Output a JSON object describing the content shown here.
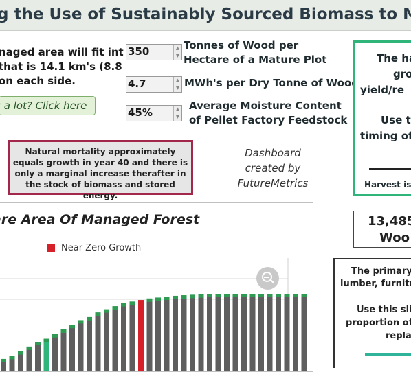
{
  "header": {
    "title": "g the Use of Sustainably Sourced Biomass to Make O"
  },
  "intro": {
    "lines": [
      "naged area will fit into",
      "that is 14.1 km's (8.8",
      "on each side."
    ],
    "link_label": "is a lot? Click here"
  },
  "inputs": [
    {
      "value": "350",
      "label_lines": [
        "Tonnes of Wood per",
        "Hectare of a Mature Plot"
      ]
    },
    {
      "value": "4.7",
      "label_lines": [
        "MWh's per Dry Tonne of Wood"
      ]
    },
    {
      "value": "45%",
      "label_lines": [
        "Average Moisture Content",
        "of Pellet Factory Feedstock"
      ]
    }
  ],
  "notice": {
    "text": "Natural mortality approximately equals growth in year 40 and there is only a marginal increase therafter in the stock of biomass and stored energy."
  },
  "credit": {
    "lines": [
      "Dashboard",
      "created by",
      "FutureMetrics"
    ]
  },
  "right_panel": {
    "lines": [
      "The ha",
      "gro",
      "yield/re",
      "Use thi",
      "timing of"
    ],
    "footer": "Harvest is"
  },
  "count_box": {
    "line1": "13,485",
    "line2": "Woo"
  },
  "primary_box": {
    "lines": [
      "The primary",
      "lumber, furnitu",
      "Use this slic",
      "proportion of",
      "repla"
    ]
  },
  "chart": {
    "title": "are Area Of Managed Forest",
    "legend_label": "Near Zero Growth"
  },
  "colors": {
    "bar": "#5e5e5e",
    "cap": "#2f9a52",
    "highlight": "#d6202a",
    "early": "#2fb47a",
    "accent_green": "#2fb47a",
    "notice_border": "#a3274a"
  },
  "chart_data": {
    "type": "bar",
    "title": "are Area Of Managed Forest",
    "legend": [
      "Near Zero Growth"
    ],
    "highlight_index": 16,
    "early_highlight_index": 5,
    "values": [
      8,
      10,
      13,
      16,
      19,
      21,
      24,
      27,
      30,
      33,
      35,
      38,
      40,
      42,
      44,
      45,
      46,
      47,
      47.6,
      48.2,
      48.7,
      49.1,
      49.4,
      49.7,
      50,
      50,
      50,
      50,
      50,
      50,
      50,
      50,
      50,
      50,
      50,
      50
    ],
    "ylim": [
      0,
      52
    ]
  }
}
